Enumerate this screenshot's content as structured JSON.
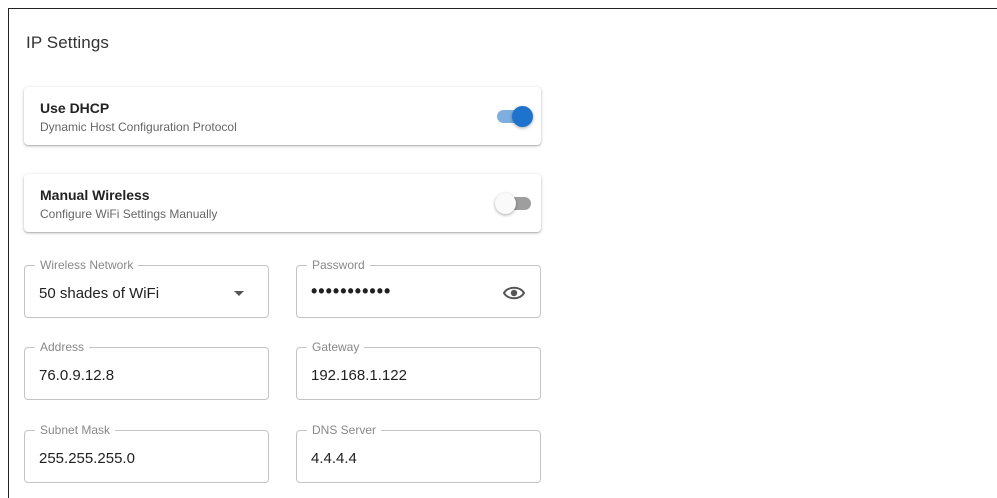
{
  "page": {
    "title": "IP Settings"
  },
  "dhcp": {
    "title": "Use DHCP",
    "subtitle": "Dynamic Host Configuration Protocol",
    "enabled": true
  },
  "manual_wireless": {
    "title": "Manual Wireless",
    "subtitle": "Configure WiFi Settings Manually",
    "enabled": false
  },
  "fields": {
    "wireless_network": {
      "label": "Wireless Network",
      "value": "50 shades of WiFi",
      "icon": "chevron-down-icon"
    },
    "password": {
      "label": "Password",
      "value": "•••••••••••",
      "icon": "eye-icon"
    },
    "address": {
      "label": "Address",
      "value": "76.0.9.12.8"
    },
    "gateway": {
      "label": "Gateway",
      "value": "192.168.1.122"
    },
    "subnet_mask": {
      "label": "Subnet Mask",
      "value": "255.255.255.0"
    },
    "dns_server": {
      "label": "DNS Server",
      "value": "4.4.4.4"
    }
  },
  "colors": {
    "accent": "#1e73cf",
    "accent_track": "#7faee0",
    "toggle_off_track": "#9e9e9e"
  }
}
